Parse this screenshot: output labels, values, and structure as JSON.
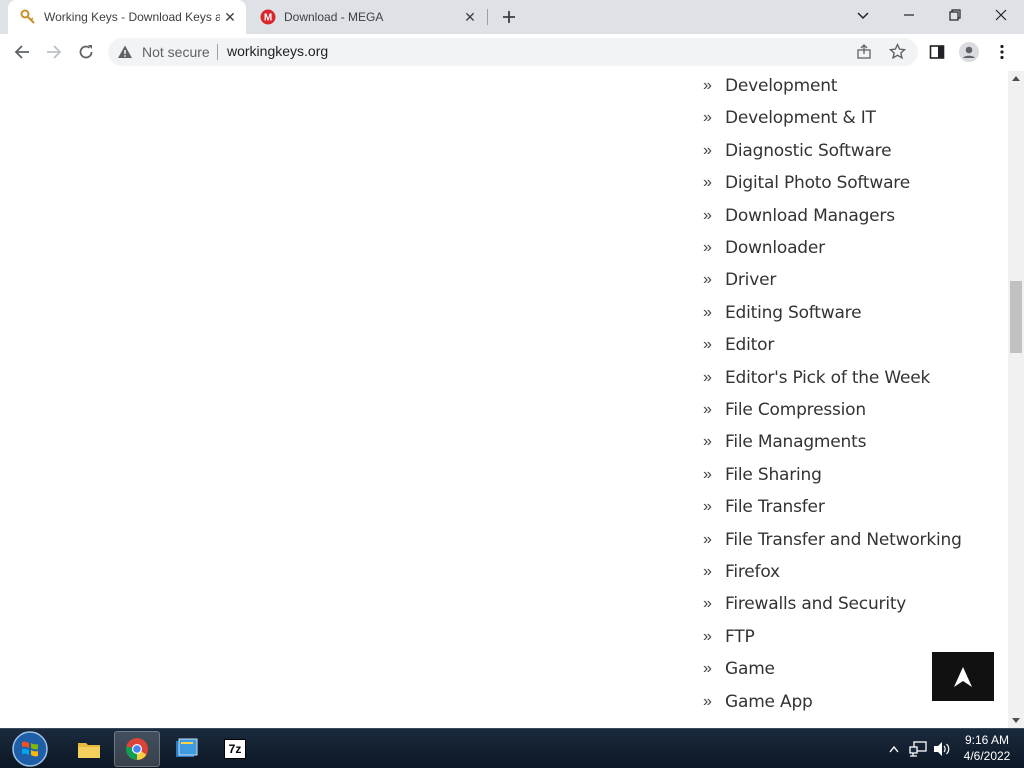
{
  "browser": {
    "tabs": [
      {
        "title": "Working Keys - Download Keys a",
        "active": true,
        "favicon": "key-icon"
      },
      {
        "title": "Download - MEGA",
        "active": false,
        "favicon": "mega-icon"
      }
    ],
    "address": {
      "security_label": "Not secure",
      "url": "workingkeys.org"
    }
  },
  "page": {
    "categories": [
      "Development",
      "Development & IT",
      "Diagnostic Software",
      "Digital Photo Software",
      "Download Managers",
      "Downloader",
      "Driver",
      "Editing Software",
      "Editor",
      "Editor's Pick of the Week",
      "File Compression",
      "File Managments",
      "File Sharing",
      "File Transfer",
      "File Transfer and Networking",
      "Firefox",
      "Firewalls and Security",
      "FTP",
      "Game",
      "Game App"
    ],
    "bullet": "»",
    "scroll_top_icon": "arrow-up-icon"
  },
  "taskbar": {
    "pinned": [
      "file-explorer-icon",
      "chrome-icon",
      "app-icon",
      "7zip-icon"
    ],
    "seven_zip_label": "7z",
    "clock_time": "9:16 AM",
    "clock_date": "4/6/2022"
  },
  "colors": {
    "tabstrip_bg": "#dee1e6",
    "taskbar_bg": "#0c1724",
    "mega_red": "#d9272e",
    "text": "#333333"
  }
}
